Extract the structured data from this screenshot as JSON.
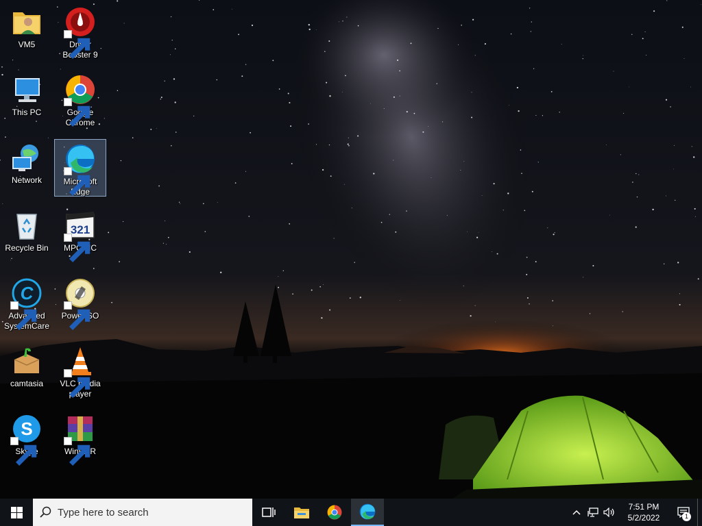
{
  "desktop": {
    "icons": [
      {
        "label": "VM5",
        "icon": "user-folder-icon"
      },
      {
        "label": "Driver Booster 9",
        "icon": "driver-booster-icon"
      },
      {
        "label": "This PC",
        "icon": "this-pc-icon"
      },
      {
        "label": "Google Chrome",
        "icon": "chrome-icon"
      },
      {
        "label": "Network",
        "icon": "network-icon"
      },
      {
        "label": "Microsoft Edge",
        "icon": "edge-icon",
        "selected": true
      },
      {
        "label": "Recycle Bin",
        "icon": "recycle-bin-icon"
      },
      {
        "label": "MPC-HC",
        "icon": "mpc-hc-icon"
      },
      {
        "label": "Advanced SystemCare",
        "icon": "advanced-systemcare-icon"
      },
      {
        "label": "PowerISO",
        "icon": "poweriso-icon"
      },
      {
        "label": "camtasia",
        "icon": "camtasia-icon"
      },
      {
        "label": "VLC media player",
        "icon": "vlc-icon"
      },
      {
        "label": "Skype",
        "icon": "skype-icon"
      },
      {
        "label": "WinRAR",
        "icon": "winrar-icon"
      }
    ]
  },
  "taskbar": {
    "search_placeholder": "Type here to search",
    "pinned": [
      "task-view-icon",
      "file-explorer-icon",
      "chrome-icon",
      "edge-icon"
    ],
    "active_app": "edge-icon",
    "clock_time": "7:51 PM",
    "clock_date": "5/2/2022",
    "notification_count": "1"
  },
  "colors": {
    "taskbar": "#101418",
    "selection": "#7896be",
    "tent": "#9bd23c"
  }
}
